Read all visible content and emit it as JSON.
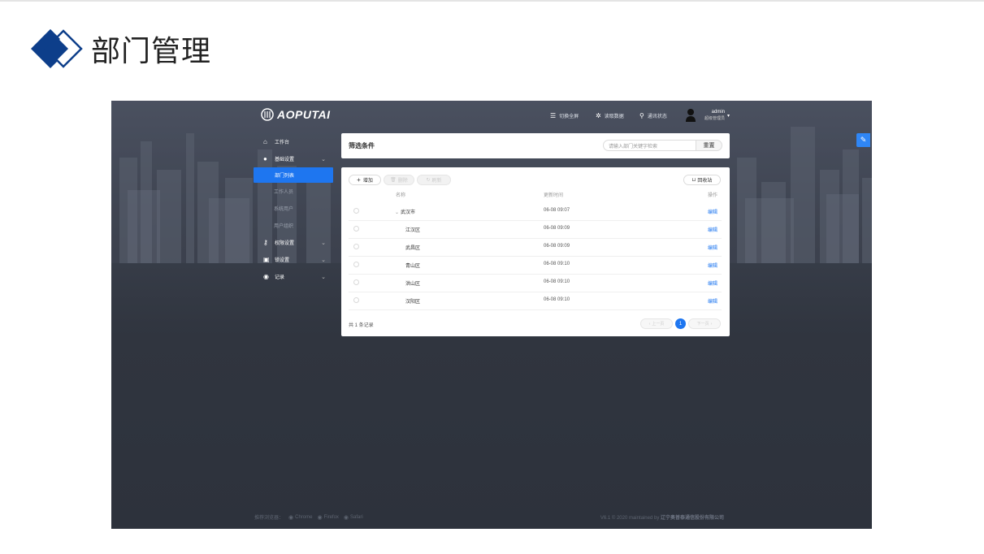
{
  "slide": {
    "title": "部门管理"
  },
  "app": {
    "brand": "AOPUTAI",
    "topbar": {
      "fullscreen": "切换全屏",
      "read_data": "读取数据",
      "comm_status": "通讯状态",
      "user_name": "admin",
      "user_role": "超级管理员"
    },
    "sidebar": {
      "workbench": "工作台",
      "basic_settings": "基础设置",
      "basic_items": [
        "部门列表",
        "工作人员",
        "系统用户",
        "用户组织"
      ],
      "permission_settings": "权限设置",
      "lock_settings": "锁设置",
      "records": "记录"
    },
    "filter": {
      "title": "筛选条件",
      "search_placeholder": "请输入部门关键字检索",
      "reset": "重置"
    },
    "table": {
      "add": "增加",
      "delete": "删除",
      "refresh": "刷新",
      "recycle": "回收站",
      "headers": {
        "name": "名称",
        "time": "更新时间",
        "action": "操作"
      },
      "rows": [
        {
          "name": "武汉市",
          "time": "06-08 09:07",
          "action": "编辑"
        },
        {
          "name": "江汉区",
          "time": "06-08 09:09",
          "action": "编辑"
        },
        {
          "name": "武昌区",
          "time": "06-08 09:09",
          "action": "编辑"
        },
        {
          "name": "青山区",
          "time": "06-08 09:10",
          "action": "编辑"
        },
        {
          "name": "洪山区",
          "time": "06-08 09:10",
          "action": "编辑"
        },
        {
          "name": "汉阳区",
          "time": "06-08 09:10",
          "action": "编辑"
        }
      ],
      "total": "共 1 条记录",
      "prev": "上一页",
      "page": "1",
      "next": "下一页"
    },
    "footer": {
      "browsers_label": "推荐浏览器：",
      "chrome": "Chrome",
      "firefox": "Firefox",
      "safari": "Safari",
      "copyright": "V6.1 © 2020 maintained by",
      "company": "辽宁奥普泰通信股份有限公司"
    },
    "colors": {
      "accent": "#1e76f0",
      "card": "#ffffff",
      "background": "#2f343e",
      "slide_logo": "#0d3e8a"
    }
  }
}
